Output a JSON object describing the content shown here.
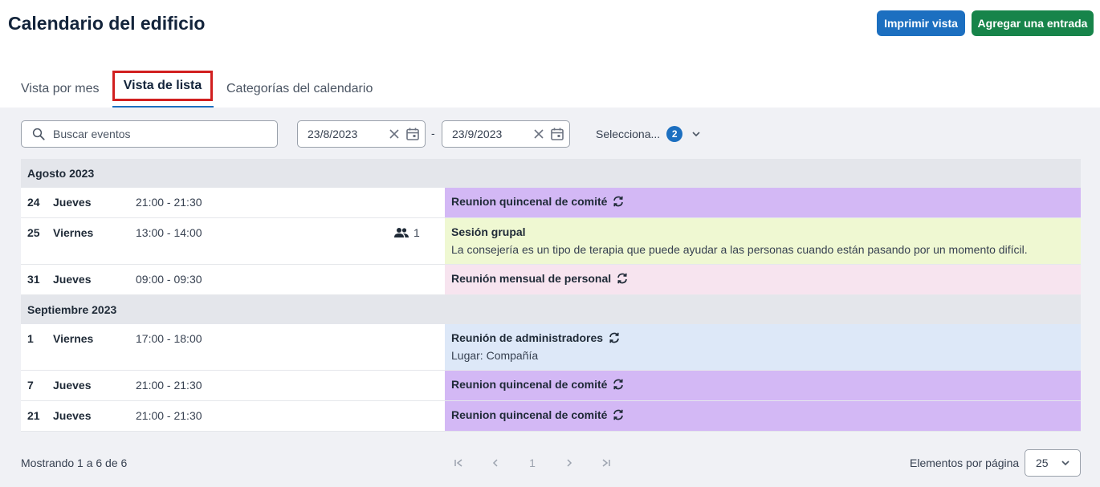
{
  "header": {
    "title": "Calendario del edificio",
    "print_label": "Imprimir vista",
    "add_label": "Agregar una entrada"
  },
  "tabs": [
    {
      "label": "Vista por mes"
    },
    {
      "label": "Vista de lista"
    },
    {
      "label": "Categorías del calendario"
    }
  ],
  "filters": {
    "search_placeholder": "Buscar eventos",
    "date_start": "23/8/2023",
    "date_end": "23/9/2023",
    "date_separator": "-",
    "select_label": "Selecciona...",
    "select_count": "2"
  },
  "months": [
    {
      "label": "Agosto 2023",
      "events": [
        {
          "day": "24",
          "weekday": "Jueves",
          "time": "21:00 - 21:30",
          "title": "Reunion quincenal de comité",
          "recurring": true,
          "color": "#d3b8f5"
        },
        {
          "day": "25",
          "weekday": "Viernes",
          "time": "13:00 - 14:00",
          "attendees": "1",
          "title": "Sesión grupal",
          "recurring": false,
          "desc": "La consejería es un tipo de terapia que puede ayudar a las personas cuando están pasando por un momento difícil.",
          "color": "#eff8d2"
        },
        {
          "day": "31",
          "weekday": "Jueves",
          "time": "09:00 - 09:30",
          "title": "Reunión mensual de personal",
          "recurring": true,
          "color": "#f7e4ef"
        }
      ]
    },
    {
      "label": "Septiembre 2023",
      "events": [
        {
          "day": "1",
          "weekday": "Viernes",
          "time": "17:00 - 18:00",
          "title": "Reunión de administradores",
          "recurring": true,
          "desc": "Lugar: Compañía",
          "color": "#dde8f8"
        },
        {
          "day": "7",
          "weekday": "Jueves",
          "time": "21:00 - 21:30",
          "title": "Reunion quincenal de comité",
          "recurring": true,
          "color": "#d3b8f5"
        },
        {
          "day": "21",
          "weekday": "Jueves",
          "time": "21:00 - 21:30",
          "title": "Reunion quincenal de comité",
          "recurring": true,
          "color": "#d3b8f5"
        }
      ]
    }
  ],
  "footer": {
    "showing": "Mostrando 1 a 6 de 6",
    "page": "1",
    "per_page_label": "Elementos por página",
    "per_page_value": "25"
  },
  "colors": {
    "primary": "#1c6fc0",
    "success": "#17844a",
    "tab_highlight": "#d11f1f"
  },
  "icons": {
    "search": "search-icon",
    "clear": "close-icon",
    "calendar": "calendar-icon",
    "recurring": "repeat-icon",
    "attendees": "people-icon"
  }
}
